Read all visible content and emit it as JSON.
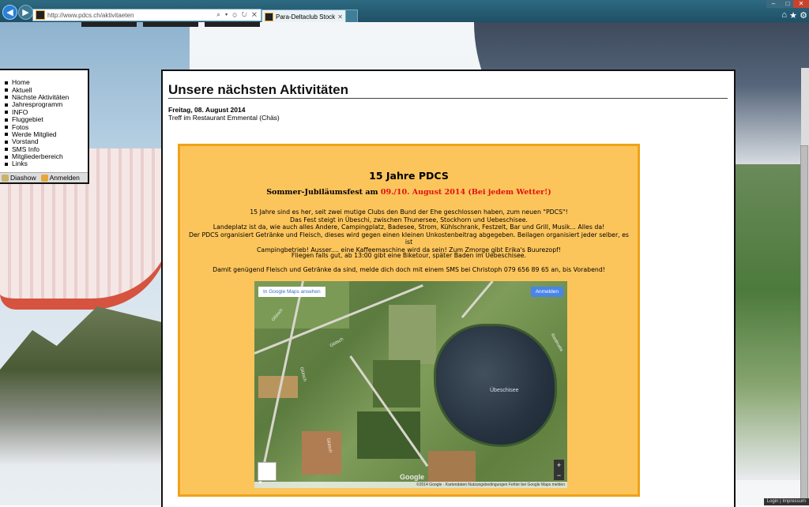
{
  "browser": {
    "url": "http://www.pdcs.ch/aktivitaeten",
    "tab_title": "Para-Deltaclub Stockhorn P...",
    "address_tools": "⌕ ▾ ⊙ ↻ ✕",
    "tab_close": "✕",
    "window_controls": {
      "min": "–",
      "max": "□",
      "close": "✕"
    },
    "right_icons": [
      "home-icon",
      "favorites-star-icon",
      "settings-gear-icon"
    ]
  },
  "sidebar": {
    "items": [
      {
        "label": "Home"
      },
      {
        "label": "Aktuell"
      },
      {
        "label": "Nächste Aktivitäten"
      },
      {
        "label": "Jahresprogramm"
      },
      {
        "label": "INFO"
      },
      {
        "label": "Fluggebiet"
      },
      {
        "label": "Fotos"
      },
      {
        "label": "Werde Mitglied"
      },
      {
        "label": "Vorstand"
      },
      {
        "label": "SMS Info"
      },
      {
        "label": "Mitgliederbereich"
      },
      {
        "label": "Links"
      }
    ],
    "footer": {
      "slideshow": "Diashow",
      "login": "Anmelden"
    }
  },
  "main": {
    "title": "Unsere nächsten Aktivitäten",
    "event_date": "Freitag, 08. August 2014",
    "event_desc": "Treff im Restaurant Emmental (Chäs)"
  },
  "announcement": {
    "title": "15 Jahre PDCS",
    "subtitle_prefix": "Sommer-Jubiläumsfest am ",
    "subtitle_highlight": "09./10. August 2014 (Bei jedem Wetter!)",
    "body_lines": [
      "15 Jahre sind es her, seit zwei mutige Clubs den Bund der Ehe geschlossen haben, zum neuen \"PDCS\"!",
      "Das Fest steigt in Übeschi, zwischen Thunersee, Stockhorn und Uebeschisee.",
      "Landeplatz ist da, wie auch alles Andere, Campingplatz, Badesee, Strom, Kühlschrank, Festzelt, Bar und Grill, Musik... Alles da!",
      "Der PDCS organisiert Getränke und Fleisch, dieses wird gegen einen kleinen Unkostenbeitrag abgegeben. Beilagen organisiert jeder selber, es ist",
      "Campingbetrieb! Ausser.... eine Kaffeemaschine wird da sein! Zum Zmorge gibt Erika's Buurezopf!"
    ],
    "fly_line": "Fliegen falls gut, ab 13:00 gibt eine Biketour, später Baden im Uebeschisee.",
    "sms_line": "Damit genügend Fleisch und Getränke da sind, melde dich doch mit einem SMS bei Christoph 079 656 89 65 an, bis Vorabend!"
  },
  "map": {
    "open_link": "In Google Maps ansehen",
    "signin": "Anmelden",
    "lake_label": "Übeschisee",
    "google_logo": "Google",
    "attribution": "©2014 Google · Kartendaten   Nutzungsbedingungen   Fehler bei Google Maps melden",
    "zoom_in": "+",
    "zoom_out": "−",
    "road_labels": [
      "Glütsch",
      "Glütsch",
      "Glütsch",
      "Glütsch",
      "Riedmatte"
    ]
  },
  "footer": {
    "links": "Login | Impressum"
  },
  "colors": {
    "announcement_bg": "#fcc55c",
    "announcement_border": "#f0a217",
    "highlight_red": "#e01010"
  }
}
